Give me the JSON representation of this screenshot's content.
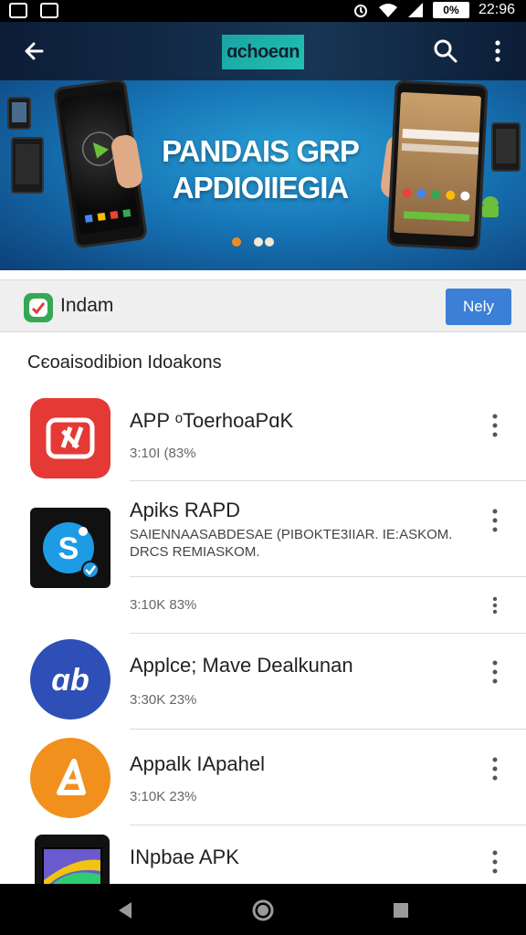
{
  "status_bar": {
    "battery": "0%",
    "time": "22:96"
  },
  "app_bar": {
    "logo_text": "ɑchoeɑn"
  },
  "banner": {
    "title_line1": "PANDAIS GRP",
    "title_line2": "APDIOIIEGIA",
    "slides": 3,
    "active_slide": 1
  },
  "install_bar": {
    "label": "Indam",
    "button": "Nely"
  },
  "section": {
    "title": "Cєoaisodibion Idoakons"
  },
  "apps": [
    {
      "title": "APP ᵒToerhoaPɑK",
      "meta": "3:10I (83%",
      "icon_color": "#e53935",
      "icon": "play-icon"
    },
    {
      "title": "Apiks RAPD",
      "desc": "SAIENNAASABDESAE (PIBOKTE3IIAR. IE:ASKOM. DRCS REMIASKOM.",
      "meta": "3:10K 83%",
      "icon_color": "#1e88e5",
      "icon": "skype-icon"
    },
    {
      "title": "Applce; Mave Dealkunan",
      "meta": "3:30K 23%",
      "icon_color": "#2e4fb5",
      "icon": "logo-icon"
    },
    {
      "title": "Appalk IApahel",
      "meta": "3:10K 23%",
      "icon_color": "#f2901e",
      "icon": "triangle-icon"
    },
    {
      "title": "INpbae APK",
      "meta": "",
      "icon_color": "#6a5acd",
      "icon": "phone-icon"
    }
  ],
  "colors": {
    "app_bar": "#10253f",
    "banner_center": "#2aa0d6",
    "accent_button": "#3b7fd6",
    "install_icon": "#35a853"
  }
}
